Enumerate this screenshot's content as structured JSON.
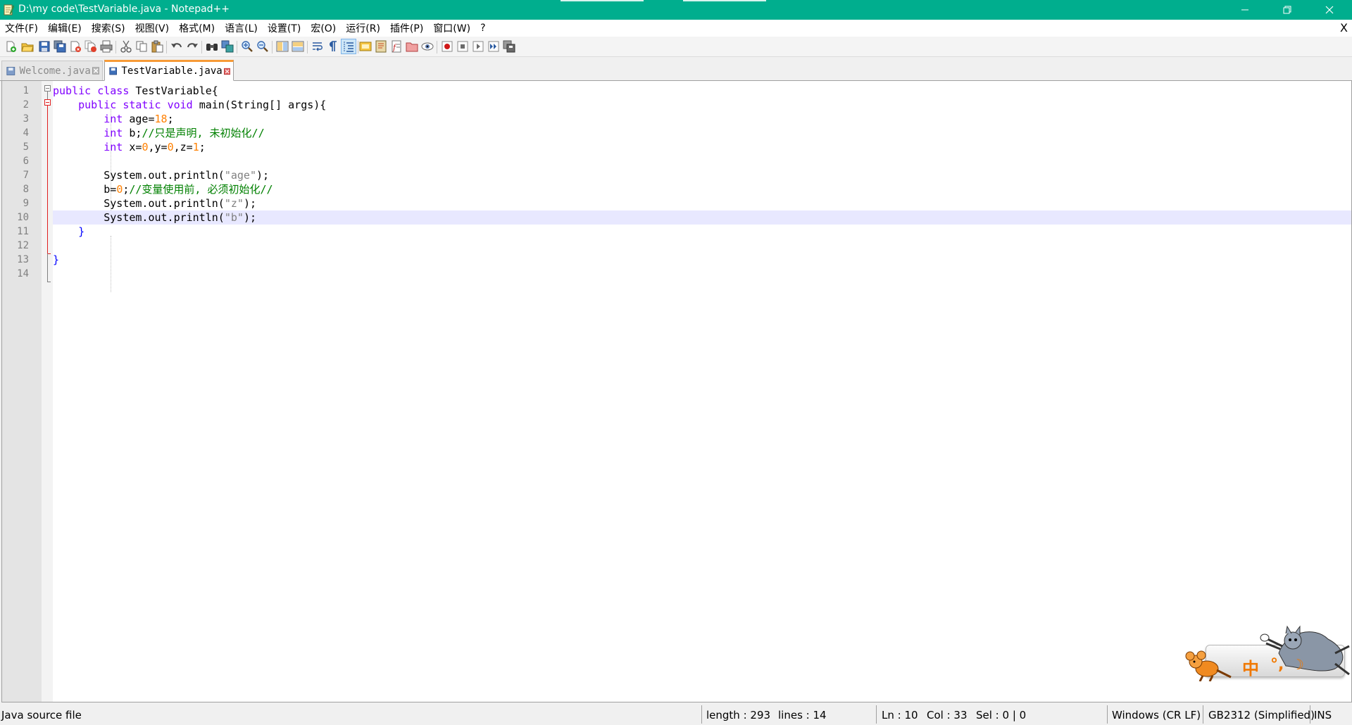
{
  "window": {
    "title": "D:\\my code\\TestVariable.java - Notepad++"
  },
  "menu": {
    "items": [
      "文件(F)",
      "编辑(E)",
      "搜索(S)",
      "视图(V)",
      "格式(M)",
      "语言(L)",
      "设置(T)",
      "宏(O)",
      "运行(R)",
      "插件(P)",
      "窗口(W)",
      "?"
    ],
    "close_label": "X"
  },
  "tabs": [
    {
      "label": "Welcome.java",
      "active": false
    },
    {
      "label": "TestVariable.java",
      "active": true
    }
  ],
  "editor": {
    "line_numbers": [
      "1",
      "2",
      "3",
      "4",
      "5",
      "6",
      "7",
      "8",
      "9",
      "10",
      "11",
      "12",
      "13",
      "14"
    ],
    "current_line": 10,
    "lines": [
      [
        [
          "kw",
          "public"
        ],
        [
          "txt",
          " "
        ],
        [
          "kw",
          "class"
        ],
        [
          "txt",
          " TestVariable{"
        ]
      ],
      [
        [
          "txt",
          "    "
        ],
        [
          "kw",
          "public"
        ],
        [
          "txt",
          " "
        ],
        [
          "kw",
          "static"
        ],
        [
          "txt",
          " "
        ],
        [
          "kw",
          "void"
        ],
        [
          "txt",
          " main(String[] args){"
        ]
      ],
      [
        [
          "txt",
          "        "
        ],
        [
          "kw",
          "int"
        ],
        [
          "txt",
          " age="
        ],
        [
          "num",
          "18"
        ],
        [
          "txt",
          ";"
        ]
      ],
      [
        [
          "txt",
          "        "
        ],
        [
          "kw",
          "int"
        ],
        [
          "txt",
          " b;"
        ],
        [
          "cmt",
          "//只是声明, 未初始化//"
        ]
      ],
      [
        [
          "txt",
          "        "
        ],
        [
          "kw",
          "int"
        ],
        [
          "txt",
          " x="
        ],
        [
          "num",
          "0"
        ],
        [
          "txt",
          ",y="
        ],
        [
          "num",
          "0"
        ],
        [
          "txt",
          ",z="
        ],
        [
          "num",
          "1"
        ],
        [
          "txt",
          ";"
        ]
      ],
      [],
      [
        [
          "txt",
          "        System.out.println("
        ],
        [
          "str",
          "\"age\""
        ],
        [
          "txt",
          ");"
        ]
      ],
      [
        [
          "txt",
          "        b="
        ],
        [
          "num",
          "0"
        ],
        [
          "txt",
          ";"
        ],
        [
          "cmt",
          "//变量使用前, 必须初始化//"
        ]
      ],
      [
        [
          "txt",
          "        System.out.println("
        ],
        [
          "str",
          "\"z\""
        ],
        [
          "txt",
          ");"
        ]
      ],
      [
        [
          "txt",
          "        System.out.println("
        ],
        [
          "str",
          "\"b\""
        ],
        [
          "txt",
          ");"
        ]
      ],
      [
        [
          "txt",
          "    "
        ],
        [
          "blue",
          "}"
        ]
      ],
      [],
      [
        [
          "blue",
          "}"
        ]
      ],
      []
    ]
  },
  "ime": {
    "mode_char": "中",
    "punct": "°,",
    "moon": "☽"
  },
  "status": {
    "file_type": "Java source file",
    "length": "length : 293",
    "lines": "lines : 14",
    "ln": "Ln : 10",
    "col": "Col : 33",
    "sel": "Sel : 0 | 0",
    "eol": "Windows (CR LF)",
    "encoding": "GB2312 (Simplified)",
    "mode": "INS"
  },
  "colors": {
    "titlebar": "#00ae8e",
    "keyword": "#8000ff",
    "number": "#ff8000",
    "string": "#808080",
    "comment": "#008000",
    "current_line": "#e8e8ff",
    "active_tab_accent": "#f79a36"
  },
  "toolbar_icons": [
    "new-file-icon",
    "open-file-icon",
    "save-icon",
    "save-all-icon",
    "close-icon",
    "close-all-icon",
    "print-icon",
    "cut-icon",
    "copy-icon",
    "paste-icon",
    "undo-icon",
    "redo-icon",
    "find-icon",
    "replace-icon",
    "zoom-in-icon",
    "zoom-out-icon",
    "sync-vertical-icon",
    "sync-horizontal-icon",
    "word-wrap-icon",
    "show-all-chars-icon",
    "indent-guide-icon",
    "user-language-icon",
    "doc-map-icon",
    "function-list-icon",
    "folder-as-workspace-icon",
    "monitoring-icon",
    "record-macro-icon",
    "stop-record-icon",
    "play-macro-icon",
    "run-macro-multiple-icon",
    "save-macro-icon"
  ]
}
